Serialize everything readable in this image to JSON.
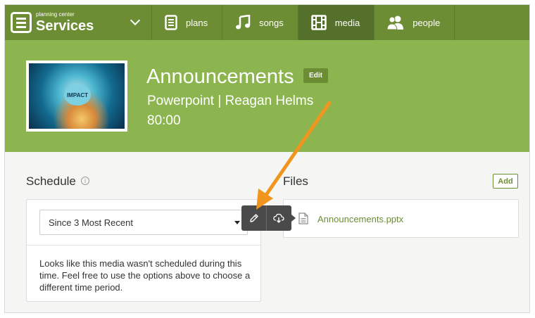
{
  "brand": {
    "sub": "planning center",
    "name": "Services"
  },
  "nav": [
    {
      "label": "plans",
      "icon": "plans-icon"
    },
    {
      "label": "songs",
      "icon": "music-note-icon"
    },
    {
      "label": "media",
      "icon": "film-icon",
      "active": true
    },
    {
      "label": "people",
      "icon": "people-icon"
    }
  ],
  "media": {
    "title": "Announcements",
    "edit_label": "Edit",
    "subtitle": "Powerpoint | Reagan Helms",
    "length": "80:00",
    "thumbnail_text": "IMPACT"
  },
  "schedule": {
    "label": "Schedule",
    "info_icon": "info-icon",
    "select_value": "Since 3 Most Recent",
    "message": "Looks like this media wasn't scheduled during this time. Feel free to use the options above to choose a different time period."
  },
  "files": {
    "label": "Files",
    "add_label": "Add",
    "items": [
      {
        "name": "Announcements.pptx",
        "icon": "document-icon"
      }
    ]
  },
  "toolbar": {
    "edit_icon": "pencil-icon",
    "download_icon": "cloud-download-icon"
  },
  "colors": {
    "nav_bg": "#6d8d34",
    "nav_active": "#55702a",
    "header_bg": "#8cb550",
    "accent": "#6d8d34",
    "annotation_arrow": "#f0961e"
  }
}
